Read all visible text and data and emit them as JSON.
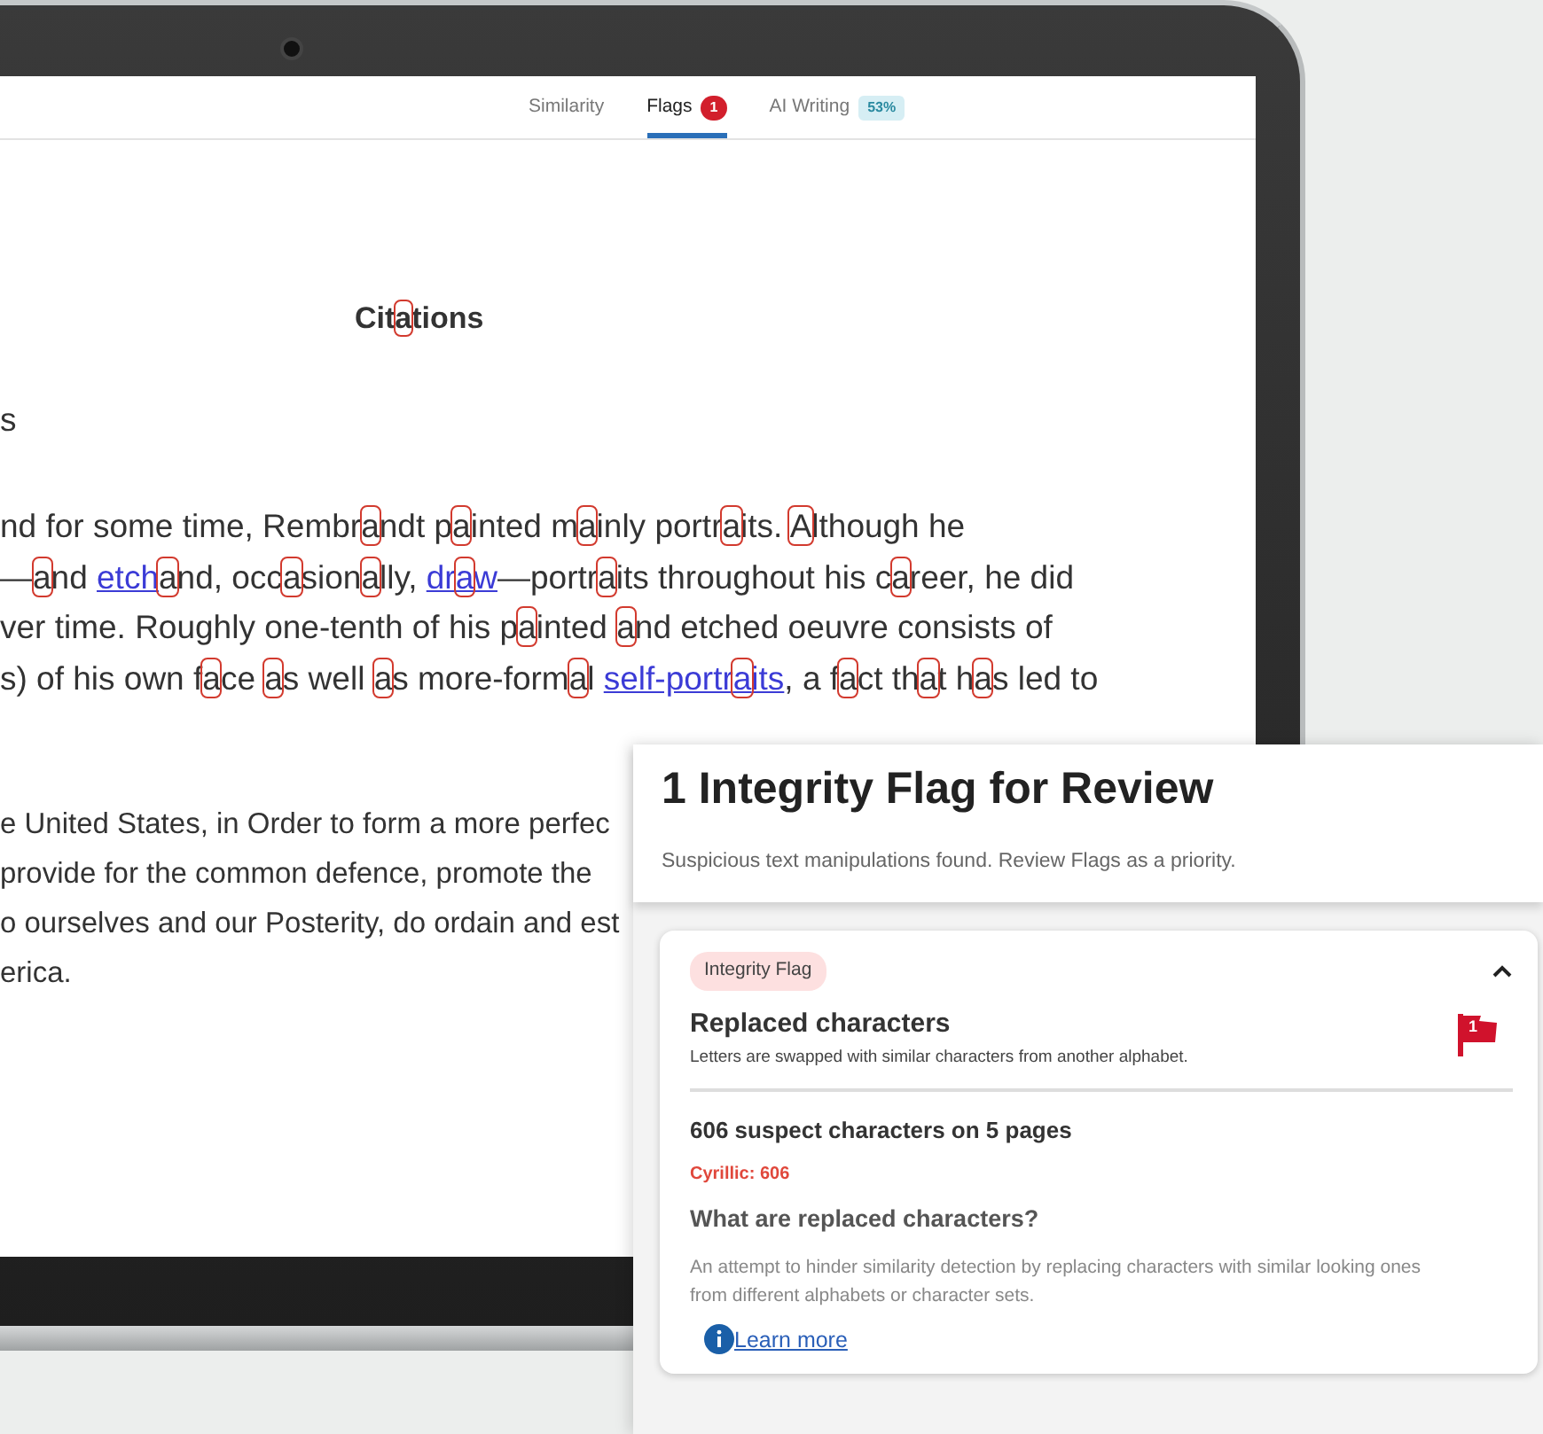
{
  "tabs": [
    {
      "label": "Similarity",
      "selected": false
    },
    {
      "label": "Flags",
      "selected": true,
      "badge": {
        "text": "1",
        "kind": "count"
      }
    },
    {
      "label": "AI Writing",
      "selected": false,
      "badge": {
        "text": "53%",
        "kind": "score"
      }
    }
  ],
  "document": {
    "heading": [
      {
        "kind": "text",
        "text": "Cit"
      },
      {
        "kind": "flag",
        "text": "a"
      },
      {
        "kind": "text",
        "text": "tions"
      }
    ],
    "fragment": "s",
    "paragraph_1": [
      [
        {
          "kind": "text",
          "text": "nd for some time, Rembr"
        },
        {
          "kind": "flag",
          "text": "a"
        },
        {
          "kind": "text",
          "text": "ndt p"
        },
        {
          "kind": "flag",
          "text": "a"
        },
        {
          "kind": "text",
          "text": "inted m"
        },
        {
          "kind": "flag",
          "text": "a"
        },
        {
          "kind": "text",
          "text": "inly portr"
        },
        {
          "kind": "flag",
          "text": "a"
        },
        {
          "kind": "text",
          "text": "its. "
        },
        {
          "kind": "flag",
          "text": "A"
        },
        {
          "kind": "text",
          "text": "lthough he"
        }
      ],
      [
        {
          "kind": "text",
          "text": "—"
        },
        {
          "kind": "flag",
          "text": "a"
        },
        {
          "kind": "text",
          "text": "nd "
        },
        {
          "kind": "link",
          "parts": [
            {
              "kind": "text",
              "text": "etch"
            }
          ]
        },
        {
          "kind": "flag",
          "text": "a"
        },
        {
          "kind": "text",
          "text": "nd, occ"
        },
        {
          "kind": "flag",
          "text": "a"
        },
        {
          "kind": "text",
          "text": "sion"
        },
        {
          "kind": "flag",
          "text": "a"
        },
        {
          "kind": "text",
          "text": "lly, "
        },
        {
          "kind": "link",
          "parts": [
            {
              "kind": "text",
              "text": "dr"
            },
            {
              "kind": "flag",
              "text": "a"
            },
            {
              "kind": "text",
              "text": "w"
            }
          ]
        },
        {
          "kind": "text",
          "text": "—portr"
        },
        {
          "kind": "flag",
          "text": "a"
        },
        {
          "kind": "text",
          "text": "its throughout his c"
        },
        {
          "kind": "flag",
          "text": "a"
        },
        {
          "kind": "text",
          "text": "reer, he did"
        }
      ],
      [
        {
          "kind": "text",
          "text": "ver time. Roughly one-tenth of his p"
        },
        {
          "kind": "flag",
          "text": "a"
        },
        {
          "kind": "text",
          "text": "inted "
        },
        {
          "kind": "flag",
          "text": "a"
        },
        {
          "kind": "text",
          "text": "nd etched oeuvre consists of"
        }
      ],
      [
        {
          "kind": "text",
          "text": "s) of his own f"
        },
        {
          "kind": "flag",
          "text": "a"
        },
        {
          "kind": "text",
          "text": "ce "
        },
        {
          "kind": "flag",
          "text": "a"
        },
        {
          "kind": "text",
          "text": "s well "
        },
        {
          "kind": "flag",
          "text": "a"
        },
        {
          "kind": "text",
          "text": "s more-form"
        },
        {
          "kind": "flag",
          "text": "a"
        },
        {
          "kind": "text",
          "text": "l "
        },
        {
          "kind": "link",
          "parts": [
            {
              "kind": "text",
              "text": "self-portr"
            },
            {
              "kind": "flag",
              "text": "a"
            },
            {
              "kind": "text",
              "text": "its"
            }
          ]
        },
        {
          "kind": "text",
          "text": ", a f"
        },
        {
          "kind": "flag",
          "text": "a"
        },
        {
          "kind": "text",
          "text": "ct th"
        },
        {
          "kind": "flag",
          "text": "a"
        },
        {
          "kind": "text",
          "text": "t h"
        },
        {
          "kind": "flag",
          "text": "a"
        },
        {
          "kind": "text",
          "text": "s led to"
        }
      ]
    ],
    "paragraph_2": [
      "e United States, in Order to form a more perfec",
      "provide for the common defence, promote the",
      "o ourselves and our Posterity, do ordain and est",
      "erica."
    ]
  },
  "flag_panel": {
    "title": "1 Integrity Flag for Review",
    "subtitle": "Suspicious text manipulations found. Review Flags as a priority.",
    "card": {
      "tag": "Integrity Flag",
      "expanded": true,
      "title": "Replaced characters",
      "description": "Letters are swapped with similar characters from another alphabet.",
      "flag_count": "1",
      "count_line": "606 suspect characters on 5 pages",
      "script_line": "Cyrillic: 606",
      "question": "What are replaced characters?",
      "explanation": "An attempt to hinder similarity detection by replacing characters with similar looking ones from different alphabets or character sets.",
      "link": "Learn more"
    }
  }
}
